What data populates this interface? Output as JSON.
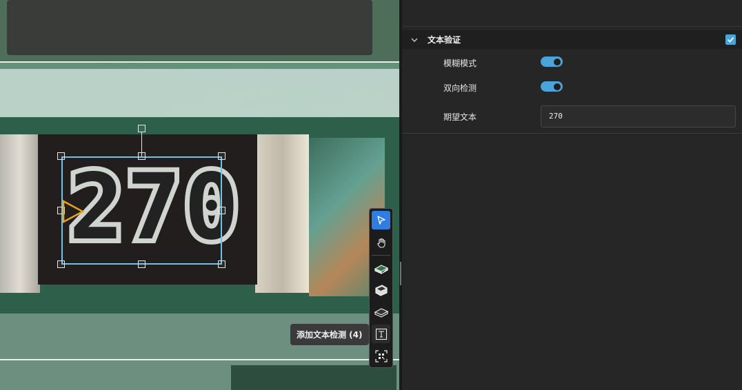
{
  "canvas": {
    "component_marking": "270"
  },
  "toolbar": {
    "tools": [
      {
        "name": "select-tool",
        "icon": "cursor-arrow-icon",
        "active": true
      },
      {
        "name": "pan-tool",
        "icon": "hand-icon",
        "active": false
      },
      {
        "name": "add-component-tool",
        "icon": "chip-green-icon",
        "active": false
      },
      {
        "name": "add-body-tool",
        "icon": "box-3d-icon",
        "active": false
      },
      {
        "name": "add-ic-tool",
        "icon": "ic-package-icon",
        "active": false
      },
      {
        "name": "add-text-tool",
        "icon": "text-box-icon",
        "active": false
      },
      {
        "name": "add-code-tool",
        "icon": "qr-code-icon",
        "active": false
      }
    ],
    "tooltip": "添加文本检测 (4)"
  },
  "panel": {
    "section_title": "文本验证",
    "section_enabled": true,
    "fuzzy_mode_label": "模糊模式",
    "fuzzy_mode_on": true,
    "bidirectional_label": "双向检测",
    "bidirectional_on": true,
    "expected_text_label": "期望文本",
    "expected_text_value": "270"
  },
  "colors": {
    "accent": "#4aa3d9",
    "active_tool": "#2f7de1",
    "selection": "#6ec3ea",
    "marker": "#e7a417"
  }
}
